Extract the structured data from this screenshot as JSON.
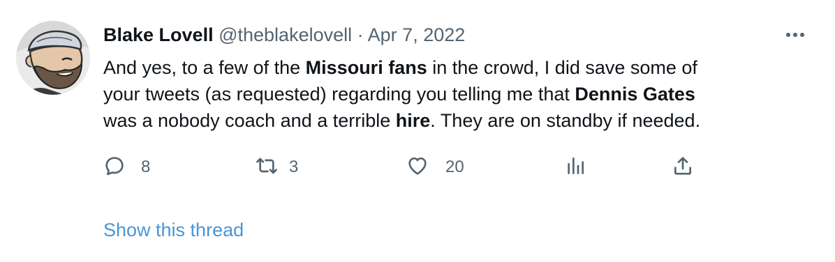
{
  "tweet": {
    "author": {
      "name": "Blake Lovell",
      "handle": "@theblakelovell"
    },
    "separator": "·",
    "date": "Apr 7, 2022",
    "more_icon": "more-dots-icon",
    "text": {
      "line1_a": "And yes, to a few of the ",
      "line1_bold": "Missouri fans",
      "line1_b": " in the crowd, I did save some of",
      "line2_a": "your tweets (as requested) regarding you telling me that ",
      "line2_bold": "Dennis Gates",
      "line3_a": "was a nobody coach and a terrible ",
      "line3_bold": "hire",
      "line3_b": ". They are on standby if needed."
    },
    "actions": {
      "reply": {
        "icon": "reply-icon",
        "count": "8"
      },
      "retweet": {
        "icon": "retweet-icon",
        "count": "3"
      },
      "like": {
        "icon": "heart-icon",
        "count": "20"
      },
      "views": {
        "icon": "analytics-icon"
      },
      "share": {
        "icon": "share-icon"
      }
    },
    "show_thread": "Show this thread",
    "colors": {
      "text": "#0f1419",
      "secondary": "#536471",
      "link": "#4a95d6"
    }
  }
}
